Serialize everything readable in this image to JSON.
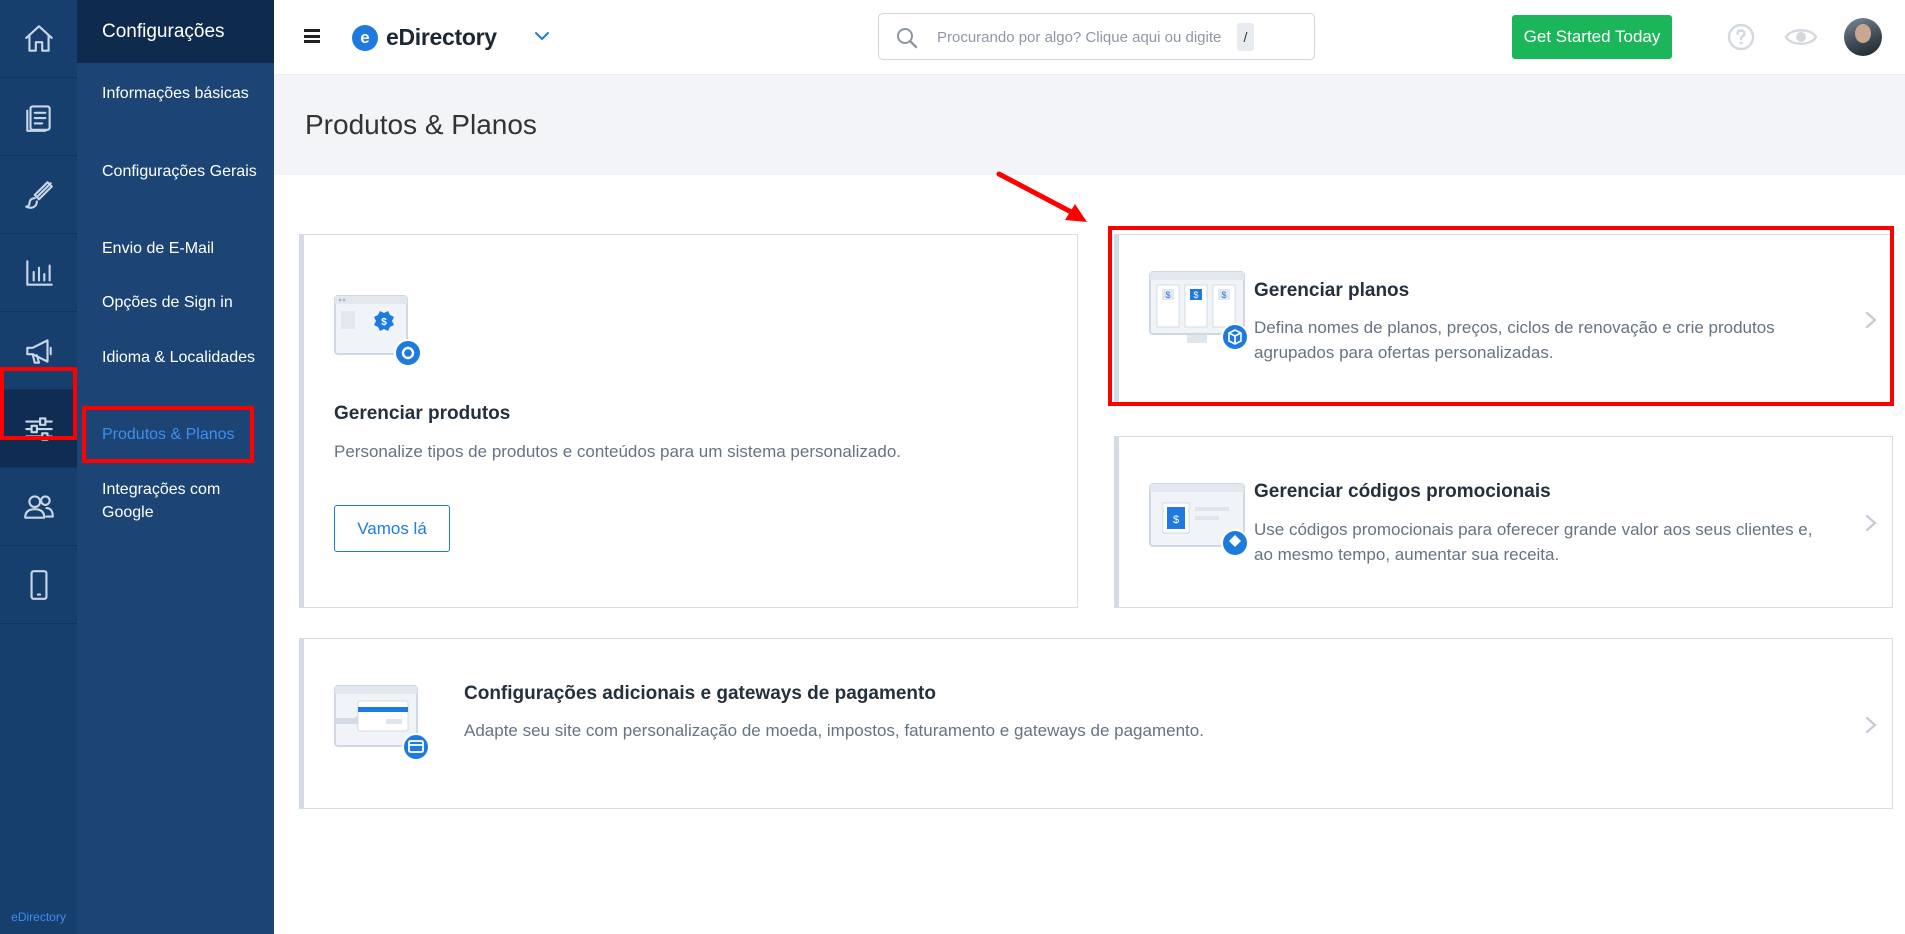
{
  "brand": {
    "name": "eDirectory",
    "accent": "#1f7ae0",
    "cta_color": "#1bb55a",
    "annotation_color": "#ff0000"
  },
  "rail": {
    "items": [
      {
        "icon": "home-icon"
      },
      {
        "icon": "content-icon"
      },
      {
        "icon": "design-brush-icon"
      },
      {
        "icon": "reports-chart-icon"
      },
      {
        "icon": "promote-megaphone-icon"
      },
      {
        "icon": "settings-sliders-icon",
        "active": true
      },
      {
        "icon": "users-icon"
      },
      {
        "icon": "mobile-icon"
      }
    ],
    "footer_label": "eDirectory"
  },
  "subnav": {
    "title": "Configurações",
    "items": [
      {
        "label": "Informações básicas"
      },
      {
        "label": "Configurações Gerais"
      },
      {
        "label": "Envio de E-Mail"
      },
      {
        "label": "Opções de Sign in"
      },
      {
        "label": "Idioma & Localidades"
      },
      {
        "label": "Produtos & Planos",
        "active": true
      },
      {
        "label": "Integrações com Google"
      }
    ]
  },
  "topbar": {
    "logo_text": "eDirectory",
    "logo_mark": "e",
    "search_placeholder": "Procurando por algo? Clique aqui ou digite",
    "search_shortcut": "/",
    "cta_label": "Get Started Today"
  },
  "page": {
    "title": "Produtos & Planos",
    "cards": {
      "products": {
        "title": "Gerenciar produtos",
        "description": "Personalize tipos de produtos e conteúdos para um sistema personalizado.",
        "button": "Vamos lá"
      },
      "plans": {
        "title": "Gerenciar planos",
        "description": "Defina nomes de planos, preços, ciclos de renovação e crie produtos agrupados para ofertas personalizadas."
      },
      "promo": {
        "title": "Gerenciar códigos promocionais",
        "description": "Use códigos promocionais para oferecer grande valor aos seus clientes e, ao mesmo tempo, aumentar sua receita."
      },
      "payments": {
        "title": "Configurações adicionais e gateways de pagamento",
        "description": "Adapte seu site com personalização de moeda, impostos, faturamento e gateways de pagamento."
      }
    }
  }
}
